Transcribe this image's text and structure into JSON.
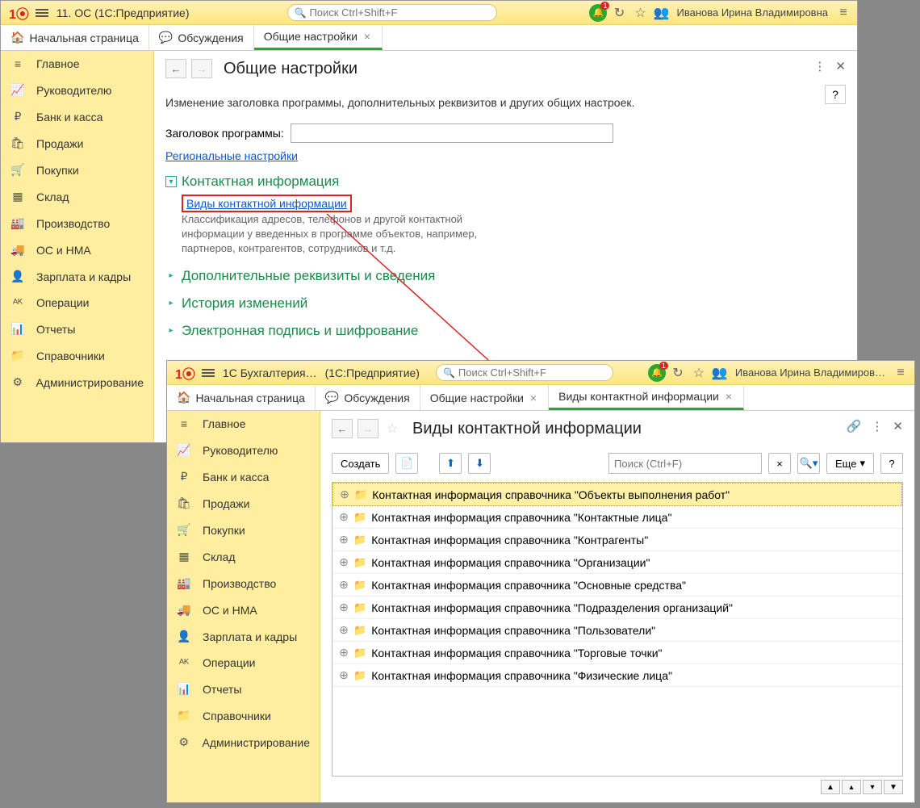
{
  "win1": {
    "title": "11. ОС   (1С:Предприятие)",
    "search_placeholder": "Поиск Ctrl+Shift+F",
    "bell_badge": "1",
    "user": "Иванова Ирина Владимировна",
    "tabs": [
      {
        "label": "Начальная страница"
      },
      {
        "label": "Обсуждения"
      },
      {
        "label": "Общие настройки",
        "active": true,
        "closable": true
      }
    ],
    "sidebar": [
      {
        "icon": "≡",
        "label": "Главное"
      },
      {
        "icon": "📈",
        "label": "Руководителю"
      },
      {
        "icon": "₽",
        "label": "Банк и касса"
      },
      {
        "icon": "🛍",
        "label": "Продажи"
      },
      {
        "icon": "🛒",
        "label": "Покупки"
      },
      {
        "icon": "▦",
        "label": "Склад"
      },
      {
        "icon": "🏭",
        "label": "Производство"
      },
      {
        "icon": "🚚",
        "label": "ОС и НМА"
      },
      {
        "icon": "👤",
        "label": "Зарплата и кадры"
      },
      {
        "icon": "ᴬᴷ",
        "label": "Операции"
      },
      {
        "icon": "📊",
        "label": "Отчеты"
      },
      {
        "icon": "📁",
        "label": "Справочники"
      },
      {
        "icon": "⚙",
        "label": "Администрирование"
      }
    ],
    "page": {
      "title": "Общие настройки",
      "desc": "Изменение заголовка программы, дополнительных реквизитов и других общих настроек.",
      "help": "?",
      "program_title_label": "Заголовок программы:",
      "regional_link": "Региональные настройки",
      "section_contact": "Контактная информация",
      "contact_types_link": "Виды контактной информации",
      "contact_desc": "Классификация адресов, телефонов и другой контактной информации у введенных в программе объектов, например, партнеров, контрагентов, сотрудников и т.д.",
      "section_extra": "Дополнительные реквизиты и сведения",
      "section_history": "История изменений",
      "section_signature": "Электронная подпись и шифрование"
    }
  },
  "win2": {
    "title_app": "1С Бухгалтерия…",
    "title_suffix": "(1С:Предприятие)",
    "search_placeholder": "Поиск Ctrl+Shift+F",
    "bell_badge": "1",
    "user": "Иванова Ирина Владимиров…",
    "tabs": [
      {
        "label": "Начальная страница"
      },
      {
        "label": "Обсуждения"
      },
      {
        "label": "Общие настройки",
        "closable": true
      },
      {
        "label": "Виды контактной информации",
        "active": true,
        "closable": true
      }
    ],
    "page": {
      "title": "Виды контактной информации",
      "create_btn": "Создать",
      "search_placeholder": "Поиск (Ctrl+F)",
      "more_btn": "Еще",
      "help": "?",
      "rows": [
        "Контактная информация справочника \"Объекты выполнения работ\"",
        "Контактная информация справочника \"Контактные лица\"",
        "Контактная информация справочника \"Контрагенты\"",
        "Контактная информация справочника \"Организации\"",
        "Контактная информация справочника \"Основные средства\"",
        "Контактная информация справочника \"Подразделения организаций\"",
        "Контактная информация справочника \"Пользователи\"",
        "Контактная информация справочника \"Торговые точки\"",
        "Контактная информация справочника \"Физические лица\""
      ]
    }
  }
}
